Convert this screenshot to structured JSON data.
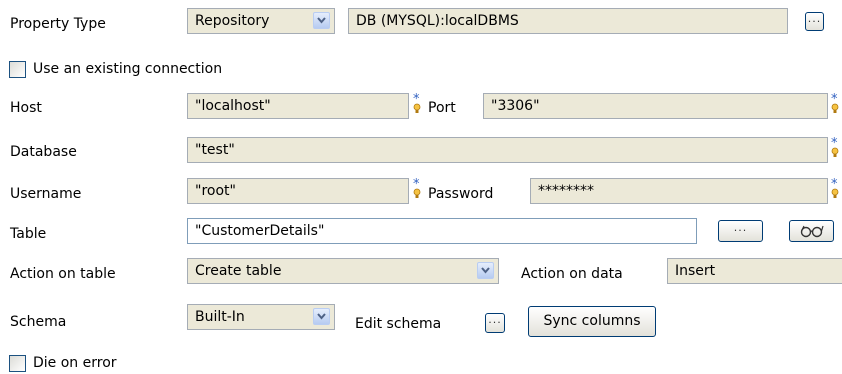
{
  "property_type": {
    "label": "Property Type",
    "mode": "Repository",
    "repository_value": "DB (MYSQL):localDBMS"
  },
  "use_existing_connection": {
    "label": "Use an existing connection",
    "checked": false
  },
  "host": {
    "label": "Host",
    "value": "\"localhost\""
  },
  "port": {
    "label": "Port",
    "value": "\"3306\""
  },
  "database": {
    "label": "Database",
    "value": "\"test\""
  },
  "username": {
    "label": "Username",
    "value": "\"root\""
  },
  "password": {
    "label": "Password",
    "value": "********"
  },
  "table": {
    "label": "Table",
    "value": "\"CustomerDetails\""
  },
  "action_on_table": {
    "label": "Action on table",
    "value": "Create table"
  },
  "action_on_data": {
    "label": "Action on data",
    "value": "Insert"
  },
  "schema": {
    "label": "Schema",
    "value": "Built-In",
    "edit_label": "Edit schema",
    "sync_label": "Sync columns"
  },
  "die_on_error": {
    "label": "Die on error",
    "checked": false
  },
  "icons": {
    "ellipsis": "ellipsis-icon",
    "warning": "required-field-warning-icon",
    "schema_guess": "guess-schema-icon",
    "dropdown": "chevron-down-icon"
  }
}
